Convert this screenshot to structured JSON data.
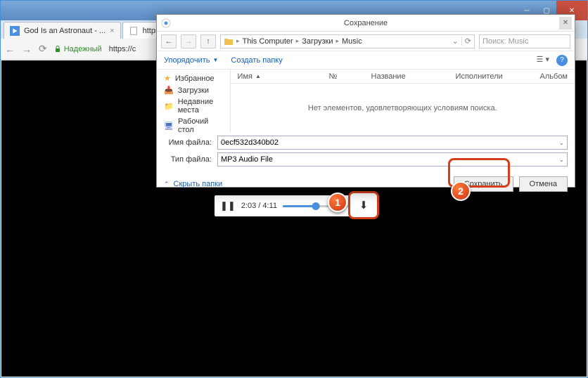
{
  "browser": {
    "tabs": [
      {
        "label": "God Is an Astronaut - ..."
      },
      {
        "label": "https://cs..."
      }
    ],
    "secure_label": "Надежный",
    "url_prefix": "https://c"
  },
  "player": {
    "time": "2:03 / 4:11"
  },
  "dialog": {
    "title": "Сохранение",
    "breadcrumb": [
      "This Computer",
      "Загрузки",
      "Music"
    ],
    "search_placeholder": "Поиск: Music",
    "toolbar": {
      "organize": "Упорядочить",
      "new_folder": "Создать папку"
    },
    "sidebar": [
      "Избранное",
      "Загрузки",
      "Недавние места",
      "Рабочий стол"
    ],
    "columns": [
      "Имя",
      "№",
      "Название",
      "Исполнители",
      "Альбом"
    ],
    "empty_message": "Нет элементов, удовлетворяющих условиям поиска.",
    "filename_label": "Имя файла:",
    "filename_value": "0ecf532d340b02",
    "filetype_label": "Тип файла:",
    "filetype_value": "MP3 Audio File",
    "hide_folders": "Скрыть папки",
    "save_btn": "Сохранить",
    "cancel_btn": "Отмена"
  },
  "callouts": {
    "one": "1",
    "two": "2"
  }
}
